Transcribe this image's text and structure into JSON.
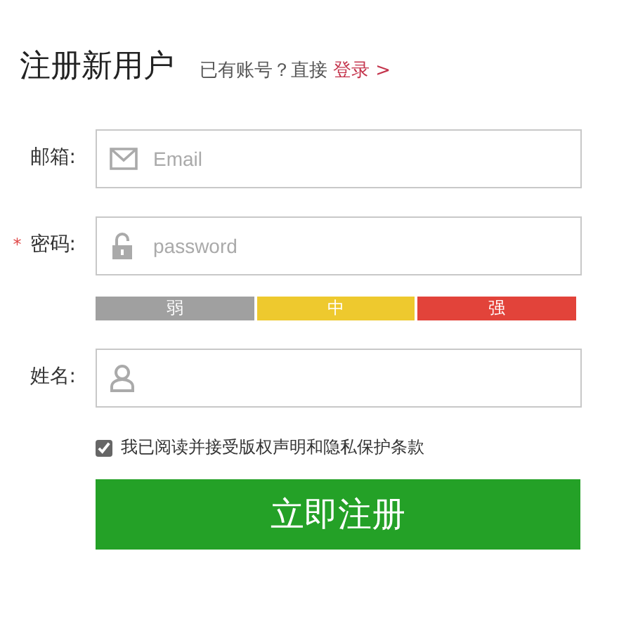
{
  "title": "注册新用户",
  "login_prompt": {
    "text": "已有账号？直接",
    "link": "登录 >"
  },
  "fields": [
    {
      "label": "邮箱:",
      "required": false,
      "kind": "email",
      "placeholder": "Email"
    },
    {
      "label": "密码:",
      "required": true,
      "required_mark": "*",
      "kind": "password",
      "placeholder": "password"
    },
    {
      "label": "姓名:",
      "required": false,
      "kind": "name"
    }
  ],
  "strength": [
    {
      "label": "弱",
      "color": "#a0a0a0"
    },
    {
      "label": "中",
      "color": "#eec92e"
    },
    {
      "label": "强",
      "color": "#e2433a"
    }
  ],
  "agreement": {
    "checked": true,
    "text": "我已阅读并接受版权声明和隐私保护条款"
  },
  "submit": "立即注册"
}
